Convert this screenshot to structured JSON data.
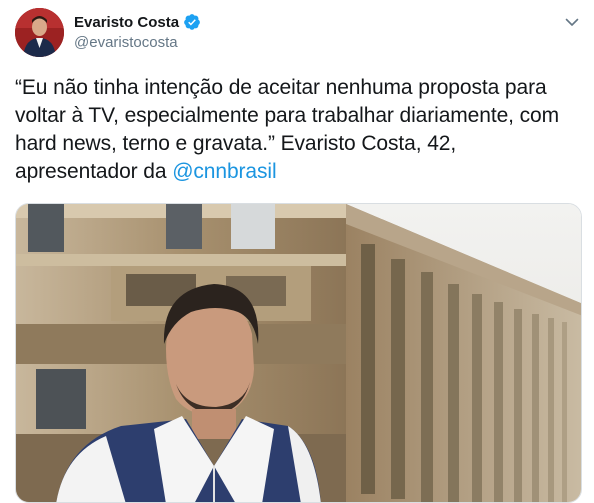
{
  "author": {
    "display_name": "Evaristo Costa",
    "handle": "@evaristocosta",
    "verified": true,
    "avatar_icon": "profile-photo"
  },
  "tweet": {
    "text_before": "“Eu não tinha intenção de aceitar nenhuma proposta para voltar à TV, especialmente para trabalhar diariamente, com hard news, terno e gravata.” Evaristo Costa, 42, apresentador da ",
    "mention": "@cnnbrasil"
  },
  "media": {
    "type": "photo",
    "icon": "photo-man-in-front-of-building"
  },
  "colors": {
    "link": "#1b95e0",
    "verified": "#1da1f2",
    "secondary_text": "#657786"
  }
}
